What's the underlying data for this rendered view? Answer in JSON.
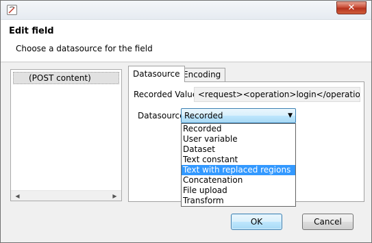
{
  "window": {
    "close_glyph": "✕",
    "app_icon": "app-icon"
  },
  "header": {
    "title": "Edit field",
    "subtitle": "Choose a datasource for the field"
  },
  "left_panel": {
    "items": [
      "(POST content)"
    ],
    "scroll_left": "◀",
    "scroll_right": "▶"
  },
  "tabs": [
    {
      "label": "Datasource",
      "active": true
    },
    {
      "label": "Encoding",
      "active": false
    }
  ],
  "form": {
    "recorded_value_label": "Recorded Value",
    "recorded_value": "<request><operation>login</operation><u",
    "datasource_label": "Datasource",
    "datasource_selected": "Recorded",
    "datasource_options": [
      "Recorded",
      "User variable",
      "Dataset",
      "Text constant",
      "Text with replaced regions",
      "Concatenation",
      "File upload",
      "Transform"
    ],
    "highlighted_option": "Text with replaced regions",
    "chevron": "▼"
  },
  "buttons": {
    "ok": "OK",
    "cancel": "Cancel"
  },
  "colors": {
    "selection": "#3399ff",
    "close": "#c6452f"
  }
}
